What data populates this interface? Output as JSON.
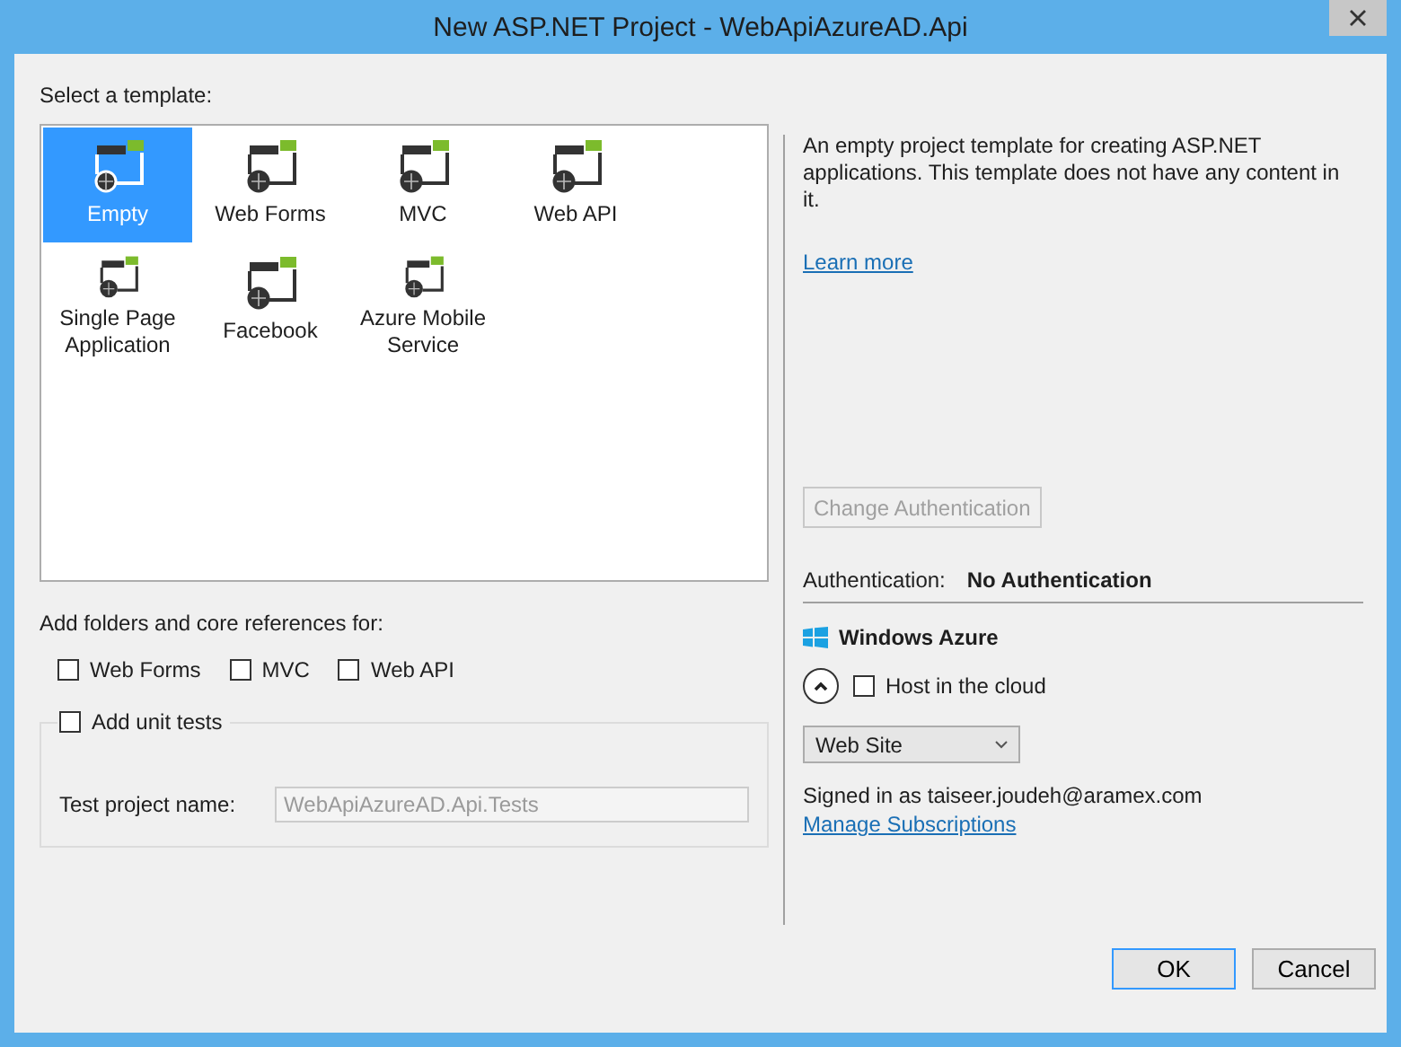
{
  "window": {
    "title": "New ASP.NET Project - WebApiAzureAD.Api"
  },
  "template_section": {
    "label": "Select a template:"
  },
  "templates": [
    {
      "label": "Empty",
      "selected": true
    },
    {
      "label": "Web Forms",
      "selected": false
    },
    {
      "label": "MVC",
      "selected": false
    },
    {
      "label": "Web API",
      "selected": false
    },
    {
      "label": "Single Page Application",
      "selected": false
    },
    {
      "label": "Facebook",
      "selected": false
    },
    {
      "label": "Azure Mobile Service",
      "selected": false
    }
  ],
  "references": {
    "label": "Add folders and core references for:",
    "options": [
      {
        "label": "Web Forms",
        "checked": false
      },
      {
        "label": "MVC",
        "checked": false
      },
      {
        "label": "Web API",
        "checked": false
      }
    ]
  },
  "unit_tests": {
    "label": "Add unit tests",
    "checked": false,
    "field_label": "Test project name:",
    "value": "WebApiAzureAD.Api.Tests",
    "disabled": true
  },
  "description": "An empty project template for creating ASP.NET applications. This template does not have any content in it.",
  "learn_more": "Learn more",
  "change_authentication": {
    "label": "Change Authentication",
    "disabled": true
  },
  "authentication": {
    "label": "Authentication:",
    "value": "No Authentication"
  },
  "azure": {
    "title": "Windows Azure",
    "expanded": true,
    "host_label": "Host in the cloud",
    "host_checked": false,
    "hosting_type": "Web Site",
    "signed_in": "Signed in as taiseer.joudeh@aramex.com",
    "manage_link": "Manage Subscriptions"
  },
  "buttons": [
    {
      "label": "OK"
    },
    {
      "label": "Cancel"
    }
  ]
}
